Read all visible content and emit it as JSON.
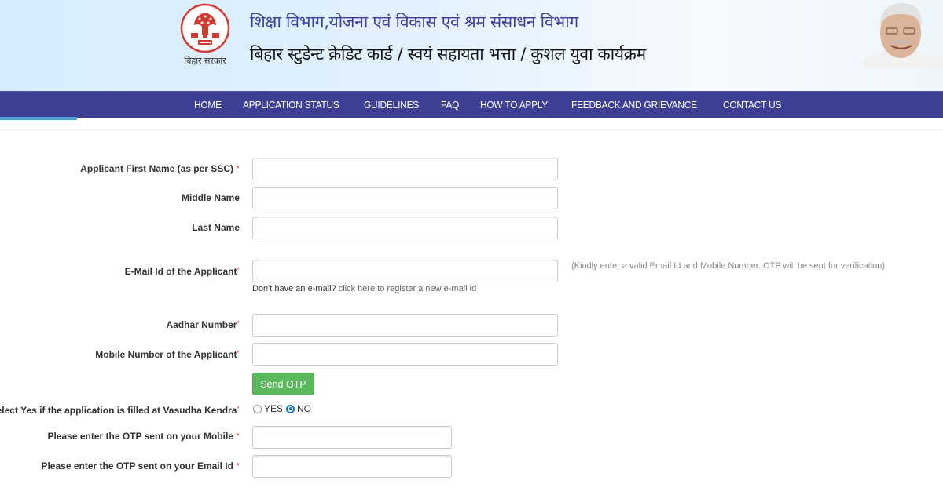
{
  "header": {
    "logo_caption": "बिहार सरकार",
    "title_line1": "शिक्षा विभाग,योजना एवं विकास एवं श्रम संसाधन विभाग",
    "title_line2": "बिहार स्टुडेन्ट क्रेडिट कार्ड / स्वयं सहायता भत्ता / कुशल युवा कार्यक्रम",
    "logo_icon": "bihar-government-emblem-icon",
    "photo": "chief-minister-photo"
  },
  "nav": {
    "items": [
      {
        "label": "HOME"
      },
      {
        "label": "APPLICATION STATUS"
      },
      {
        "label": "GUIDELINES"
      },
      {
        "label": "FAQ"
      },
      {
        "label": "HOW TO APPLY"
      },
      {
        "label": "FEEDBACK AND GRIEVANCE"
      },
      {
        "label": "CONTACT US"
      }
    ],
    "background_color": "#3c3f94"
  },
  "form": {
    "first_name": {
      "label": "Applicant First Name (as per SSC)",
      "required": "*",
      "value": ""
    },
    "middle_name": {
      "label": "Middle Name",
      "value": ""
    },
    "last_name": {
      "label": "Last Name",
      "value": ""
    },
    "email": {
      "label": "E-Mail Id of the Applicant",
      "required": "*",
      "value": "",
      "help_prefix": "Don't have an e-mail?",
      "help_link": "click here to register a new e-mail id",
      "note": "(Kindly enter a valid Email Id and Mobile Number. OTP will be sent for verification)"
    },
    "aadhar": {
      "label": "Aadhar Number",
      "required": "*",
      "value": ""
    },
    "mobile": {
      "label": "Mobile Number of the Applicant",
      "required": "*",
      "value": ""
    },
    "send_otp_label": "Send OTP",
    "vasudha": {
      "label": "Select Yes if the application is filled at Vasudha Kendra",
      "required": "*",
      "options": [
        {
          "label": "YES",
          "checked": false
        },
        {
          "label": "NO",
          "checked": true
        }
      ]
    },
    "otp_mobile": {
      "label": "Please enter the OTP sent on your Mobile",
      "required": "*",
      "value": ""
    },
    "otp_email": {
      "label": "Please enter the OTP sent on your Email Id",
      "required": "*",
      "value": ""
    }
  },
  "colors": {
    "primary_button": "#5cb85c",
    "required_marker": "#d9534f",
    "radio_selected": "#1a73c8"
  }
}
